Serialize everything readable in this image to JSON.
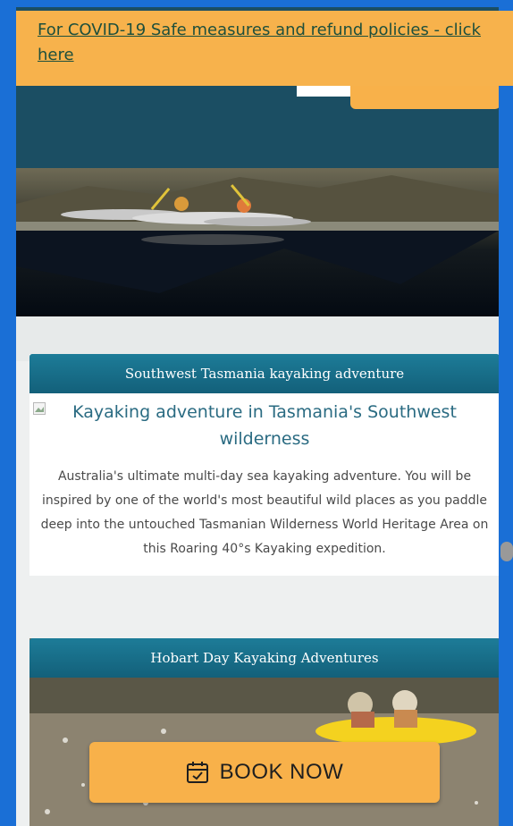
{
  "banner": {
    "text": "For COVID-19 Safe measures and refund policies - click here"
  },
  "cards": [
    {
      "title": "Southwest Tasmania kayaking adventure",
      "image_alt": "Kayaking adventure in Tasmania's Southwest wilderness",
      "description": "Australia's ultimate multi-day sea kayaking adventure. You will be inspired by one of the world's most beautiful wild places as you paddle deep into the untouched Tasmanian Wilderness World Heritage Area on this Roaring 40°s Kayaking expedition."
    },
    {
      "title": "Hobart Day Kayaking Adventures"
    }
  ],
  "cta": {
    "book_label": "BOOK NOW",
    "icon": "calendar-check-icon"
  },
  "colors": {
    "accent": "#f8b14a",
    "teal": "#1b4e63",
    "card_header": "#13607a",
    "frame": "#1a6fd6"
  }
}
